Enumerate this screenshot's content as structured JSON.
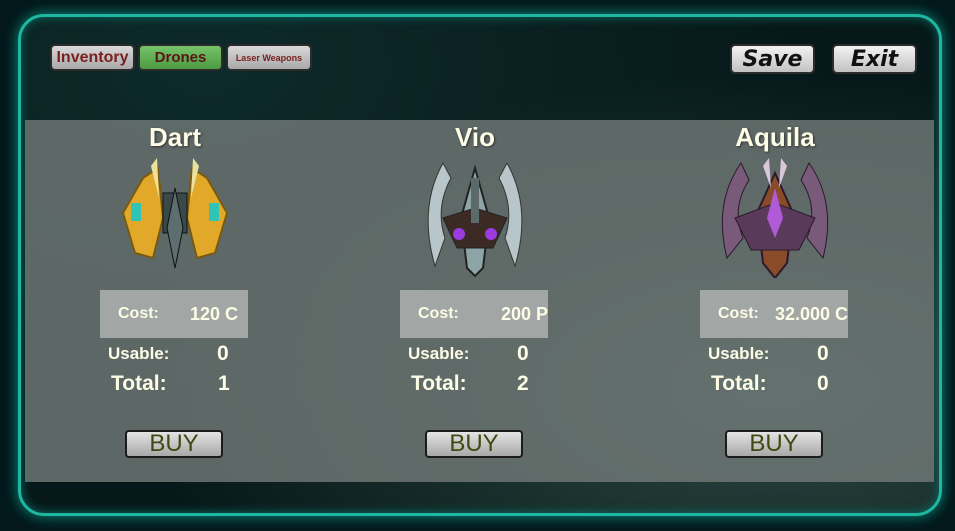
{
  "tabs": [
    {
      "label": "Inventory"
    },
    {
      "label": "Drones"
    },
    {
      "label": "Laser Weapons"
    }
  ],
  "actions": {
    "save": "Save",
    "exit": "Exit"
  },
  "labels": {
    "cost": "Cost:",
    "usable": "Usable:",
    "total": "Total:",
    "buy": "BUY"
  },
  "drones": [
    {
      "name": "Dart",
      "cost": "120 C",
      "usable": "0",
      "total": "1"
    },
    {
      "name": "Vio",
      "cost": "200 P",
      "usable": "0",
      "total": "2"
    },
    {
      "name": "Aquila",
      "cost": "32.000 C",
      "usable": "0",
      "total": "0"
    }
  ],
  "colors": {
    "frame": "#1fb7a2",
    "active_tab": "#5aa84d",
    "text": "#fdfce6"
  }
}
